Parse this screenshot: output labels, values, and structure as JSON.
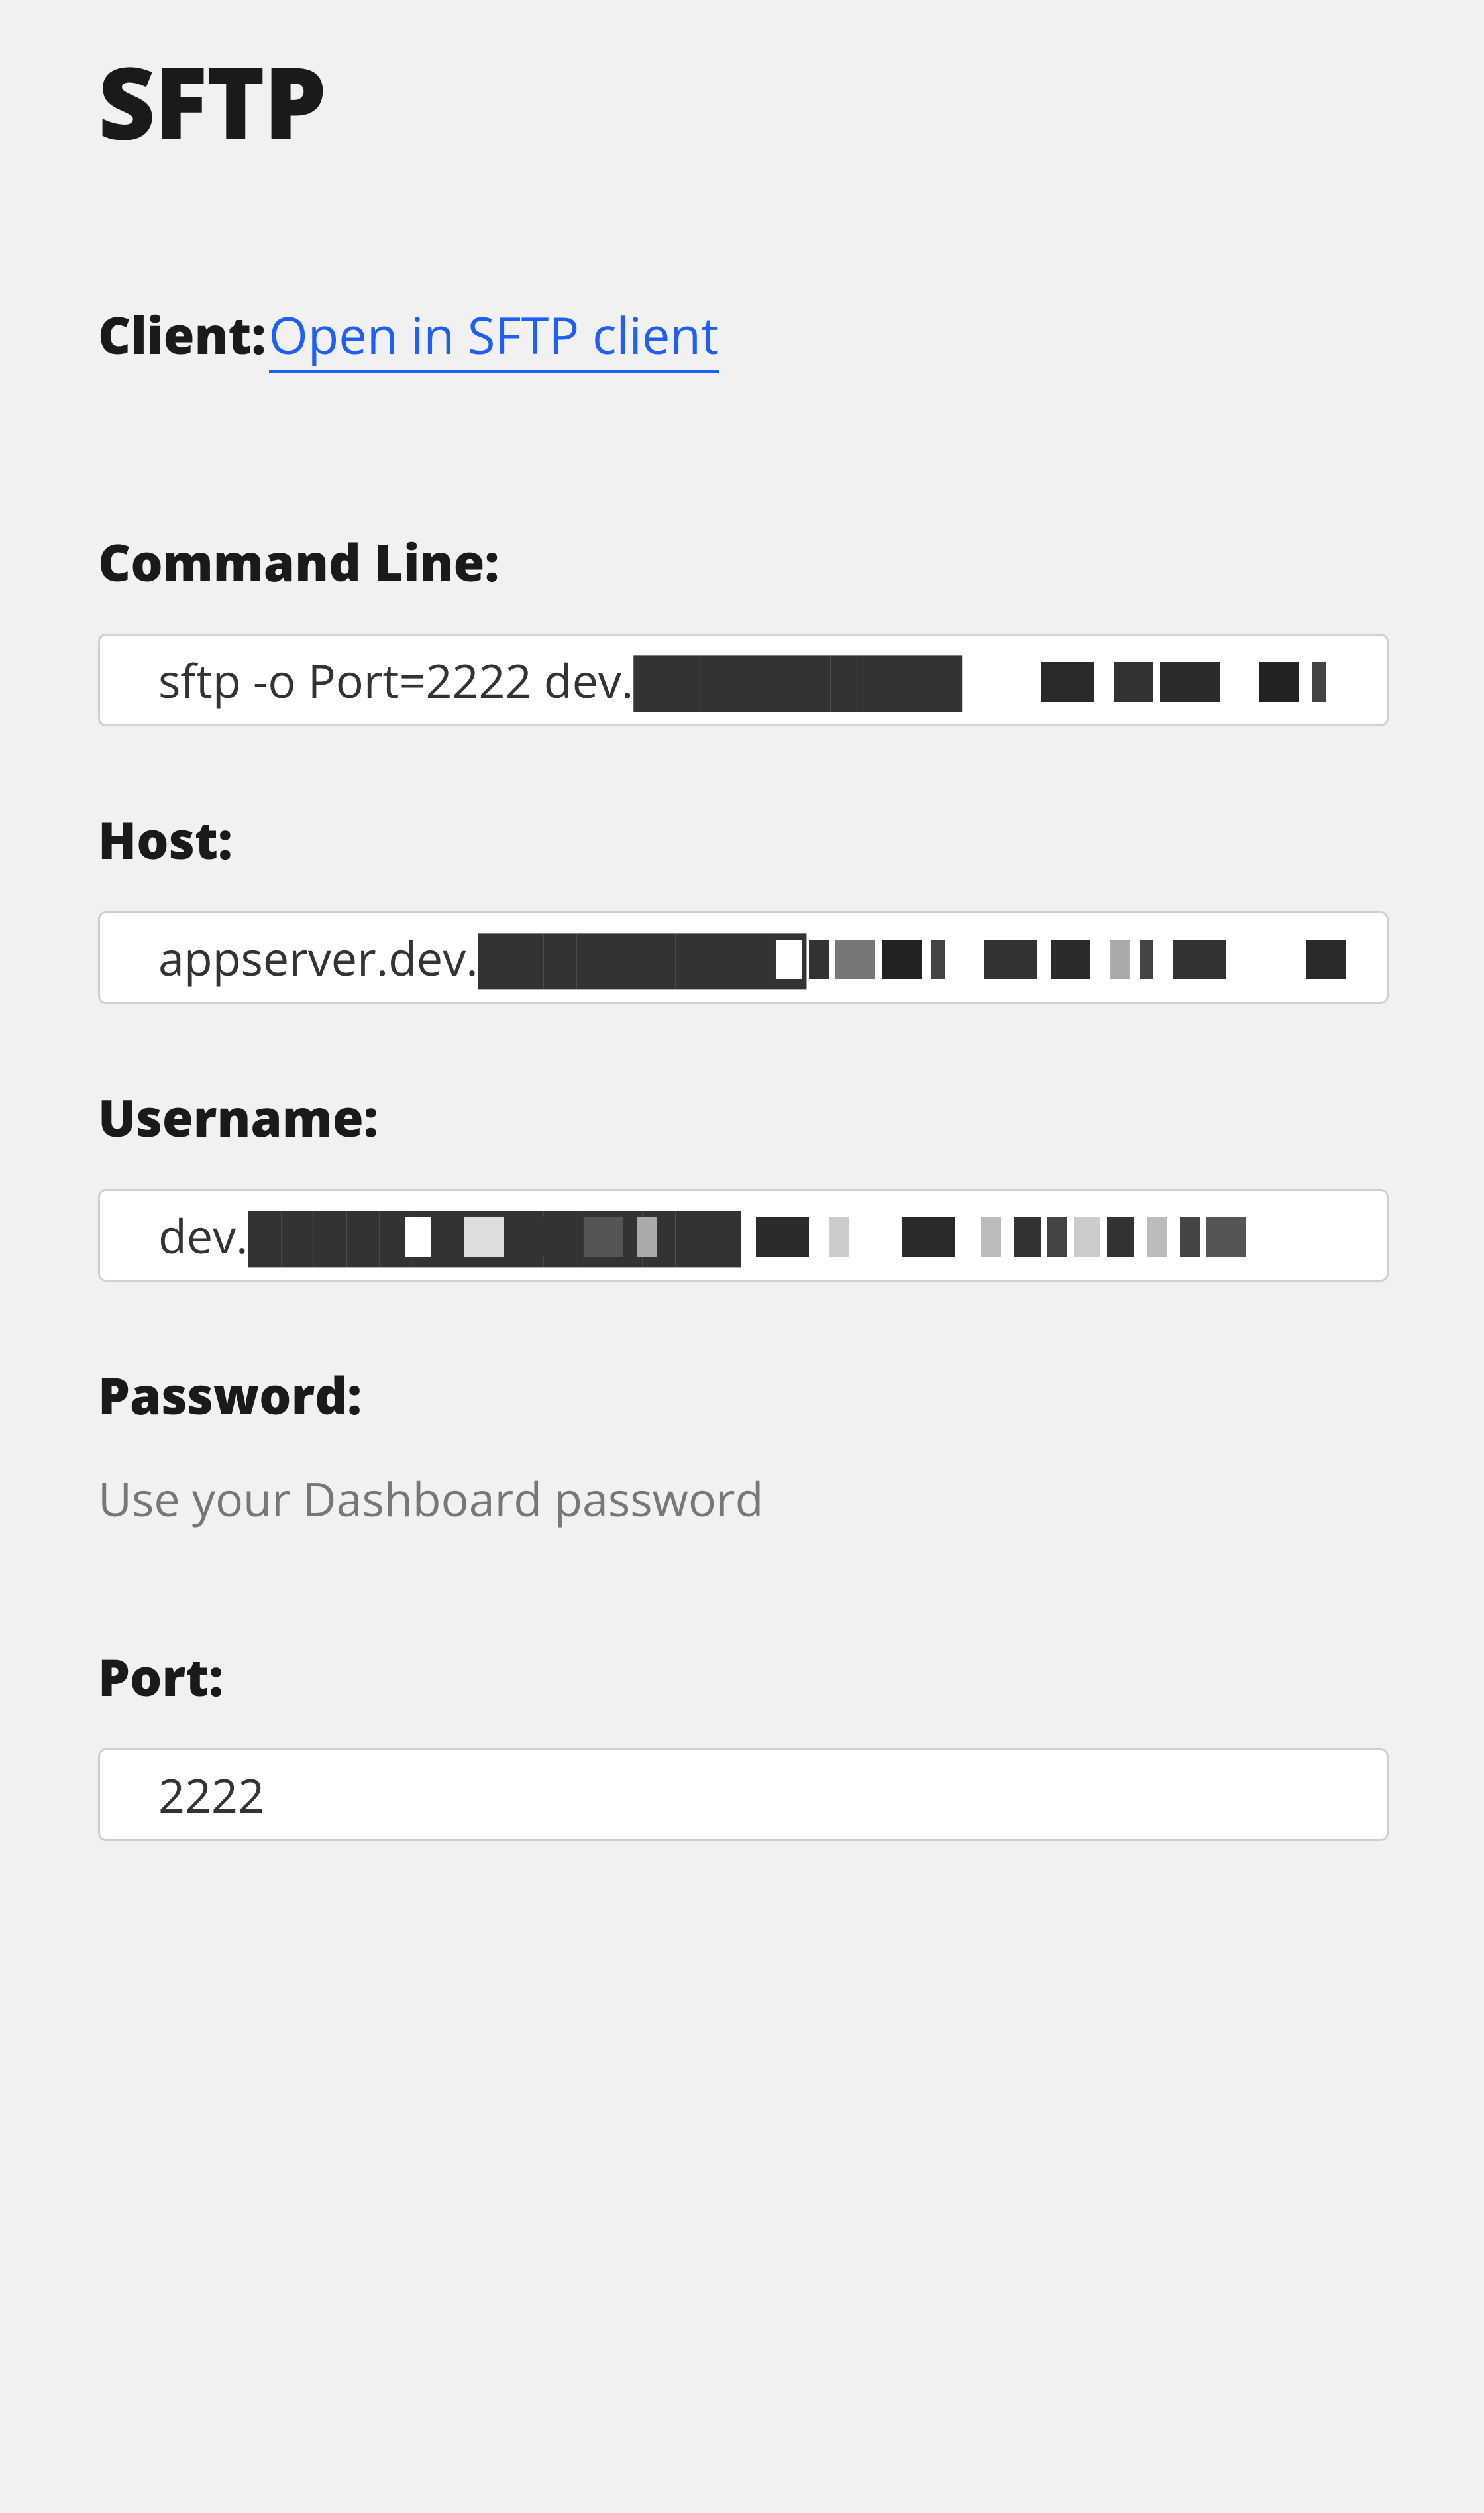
{
  "title": "SFTP",
  "client": {
    "label": "Client:",
    "link_text": "Open in SFTP client"
  },
  "commandLine": {
    "label": "Command Line:",
    "value": "sftp -o Port=2222 dev.██████████"
  },
  "host": {
    "label": "Host:",
    "value": "appserver.dev.██████████"
  },
  "username": {
    "label": "Username:",
    "value": "dev.███████████████"
  },
  "password": {
    "label": "Password:",
    "hint": "Use your Dashboard password"
  },
  "port": {
    "label": "Port:",
    "value": "2222"
  }
}
